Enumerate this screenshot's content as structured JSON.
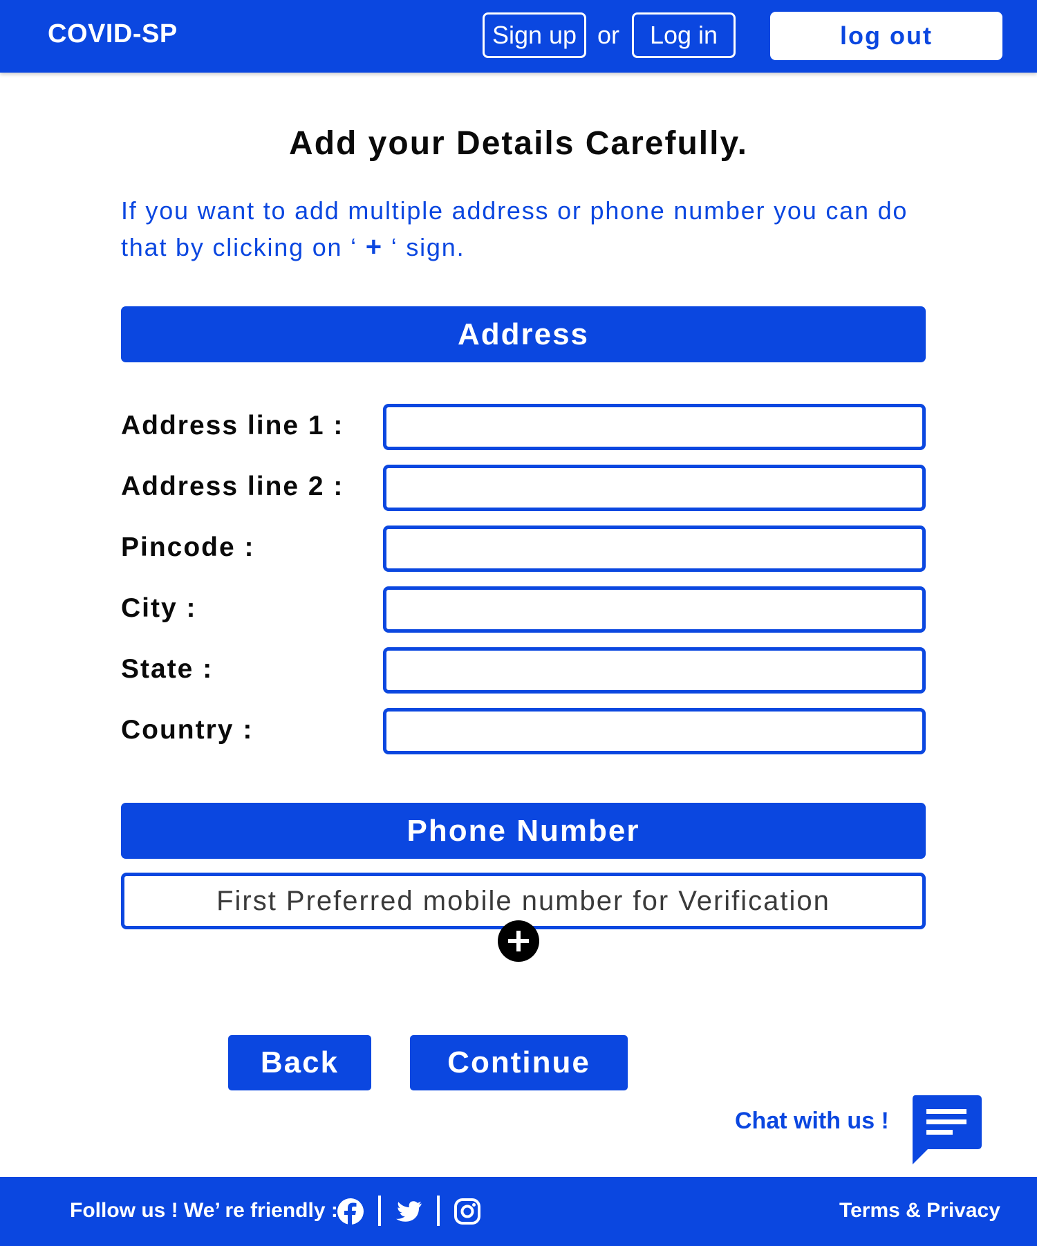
{
  "header": {
    "brand": "COVID-SP",
    "signup_label": "Sign up",
    "or_text": "or",
    "login_label": "Log in",
    "logout_label": "log out"
  },
  "main": {
    "title": "Add your Details Carefully.",
    "instruction_part1": "If you want to add multiple address or phone number you can do that by clicking on ‘ ",
    "instruction_plus": "+",
    "instruction_part2": " ‘ sign."
  },
  "address": {
    "header": "Address",
    "fields": [
      {
        "label": "Address line 1 :",
        "value": ""
      },
      {
        "label": "Address line 2 :",
        "value": ""
      },
      {
        "label": "Pincode :",
        "value": ""
      },
      {
        "label": "City :",
        "value": ""
      },
      {
        "label": "State :",
        "value": ""
      },
      {
        "label": "Country :",
        "value": ""
      }
    ]
  },
  "phone": {
    "header": "Phone Number",
    "placeholder": "First Preferred mobile number for Verification",
    "value": "",
    "add_icon": "plus-circle-icon"
  },
  "actions": {
    "back_label": "Back",
    "continue_label": "Continue"
  },
  "chat": {
    "label": "Chat with us !",
    "icon": "chat-bubble-icon"
  },
  "footer": {
    "follow_text": "Follow us !  We’ re friendly :",
    "social_icons": [
      "facebook-icon",
      "twitter-icon",
      "instagram-icon"
    ],
    "terms_label": "Terms & Privacy"
  },
  "colors": {
    "brand": "#0b47e0",
    "background": "#ffffff",
    "text": "#0a0a0a"
  }
}
